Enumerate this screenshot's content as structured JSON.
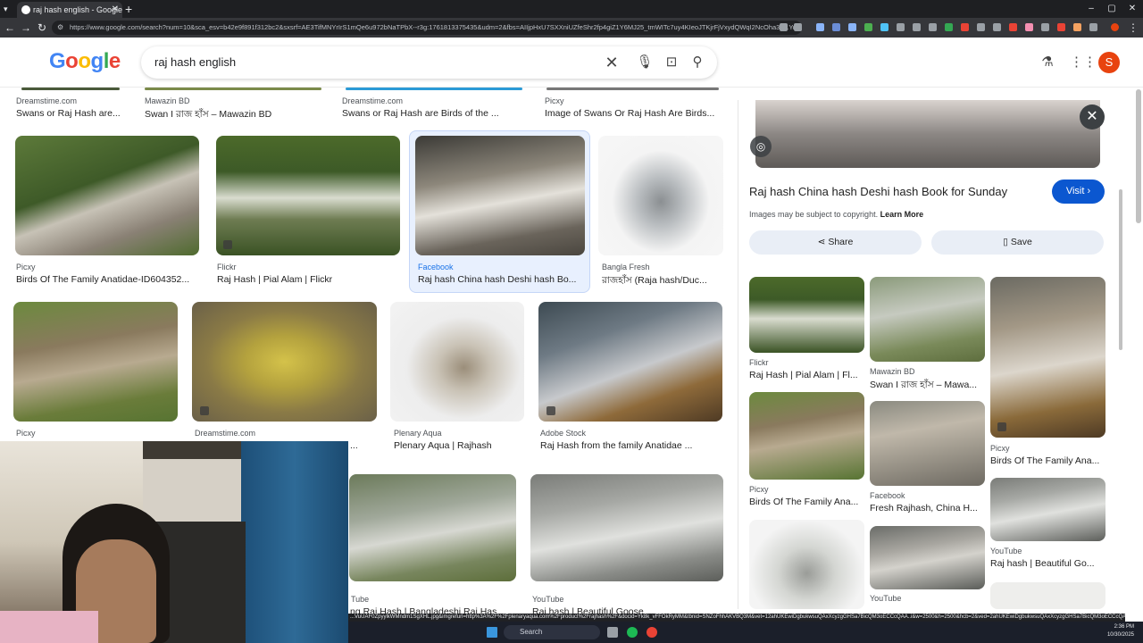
{
  "browser": {
    "tab_title": "raj hash english - Google Search",
    "url": "https://www.google.com/search?num=10&sca_esv=b42e9f891f312bc2&sxsrf=AE3TifMNYrIrS1mQe6u972bNaTPbX--r3g:1761813375435&udm=2&fbs=AIIjpHxU7SXXniUZfeShr2fp4giZ1Y6MJ25_tmWITc7uy4KIeoJTKjrFjVxydQWqI2NcOha3O1YqG67F0QIh..."
  },
  "google": {
    "logo": "Google",
    "query": "raj hash english",
    "avatar_letter": "S"
  },
  "top_row": [
    {
      "source": "Dreamstime.com",
      "title": "Swans or Raj Hash are..."
    },
    {
      "source": "Mawazin BD",
      "title": "Swan I রাজ হাঁস – Mawazin BD"
    },
    {
      "source": "Dreamstime.com",
      "title": "Swans or Raj Hash are Birds of the ..."
    },
    {
      "source": "Picxy",
      "title": "Image of Swans Or Raj Hash Are Birds..."
    }
  ],
  "row2": [
    {
      "source": "Picxy",
      "title": "Birds Of The Family Anatidae-ID604352..."
    },
    {
      "source": "Flickr",
      "title": "Raj Hash | Pial Alam | Flickr"
    },
    {
      "source": "Facebook",
      "title": "Raj hash China hash Deshi hash Bo..."
    },
    {
      "source": "Bangla Fresh",
      "title": "রাজহাঁস (Raja hash/Duc..."
    }
  ],
  "row3": [
    {
      "source": "Picxy",
      "title": ""
    },
    {
      "source": "Dreamstime.com",
      "title": "..."
    },
    {
      "source": "Plenary Aqua",
      "title": "Plenary Aqua | Rajhash"
    },
    {
      "source": "Adobe Stock",
      "title": "Raj Hash from the family Anatidae ..."
    }
  ],
  "row4": [
    {
      "source": "Tube",
      "title": "ng Raj Hash | Bangladeshi Raj Has..."
    },
    {
      "source": "YouTube",
      "title": "Raj hash | Beautiful Goose ..."
    }
  ],
  "panel": {
    "title": "Raj hash China hash Deshi hash Book for Sunday",
    "visit": "Visit",
    "copyright": "Images may be subject to copyright.",
    "learn_more": "Learn More",
    "share": "Share",
    "save": "Save",
    "related": [
      {
        "source": "Flickr",
        "title": "Raj Hash | Pial Alam | Fl..."
      },
      {
        "source": "Mawazin BD",
        "title": "Swan I রাজ হাঁস – Mawa..."
      },
      {
        "source": "Picxy",
        "title": "Birds Of The Family Ana..."
      },
      {
        "source": "Picxy",
        "title": "Birds Of The Family Ana..."
      },
      {
        "source": "Facebook",
        "title": "Fresh Rajhash, China H..."
      },
      {
        "source": "YouTube",
        "title": "Raj hash | Beautiful Go..."
      },
      {
        "source": "YouTube",
        "title": ""
      }
    ]
  },
  "taskbar": {
    "search": "Search",
    "time": "2:36 PM",
    "date": "10/30/2025"
  },
  "status_url": "...VuUAF0ZpyylkWMndm1SgXHL.jpg&imgrefurl=http%3A%2F%2Fplenaryaqua.com%2Fproduct%2Frajhash%2F&docid=Yk8k_vFFOkRyMM&tbnid=SNZoFhhAKVBQ3M&vet=12ahUKEwiDgbukwsuQAxXcyzgGHSa7BicQM3oECCcQAA..i&w=2500&h=2500&hcb=2&ved=2ahUKEwiDgbukwsuQAxXcyzgGHSa7BicQM3oECCcQAA",
  "colors": {
    "accent": "#0b57d0",
    "avatar": "#e8430f",
    "chrome_dark": "#35363a"
  }
}
